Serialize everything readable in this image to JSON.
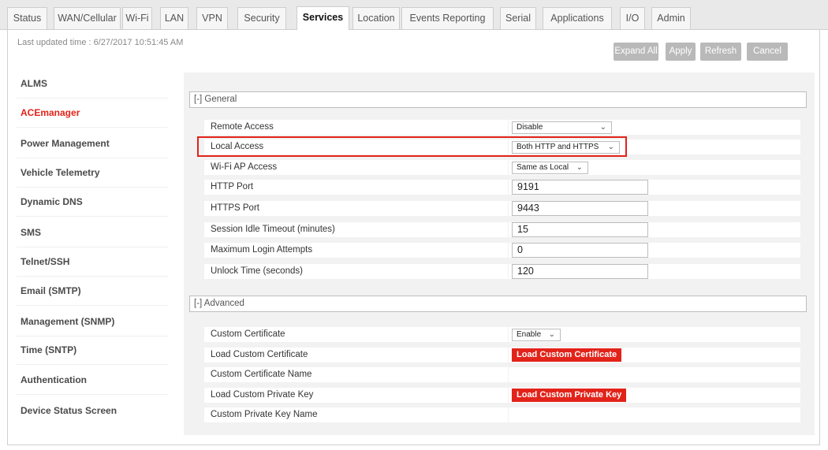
{
  "tabs": [
    {
      "label": "Status",
      "active": false
    },
    {
      "label": "WAN/Cellular",
      "active": false
    },
    {
      "label": "Wi-Fi",
      "active": false
    },
    {
      "label": "LAN",
      "active": false
    },
    {
      "label": "VPN",
      "active": false
    },
    {
      "label": "Security",
      "active": false
    },
    {
      "label": "Services",
      "active": true
    },
    {
      "label": "Location",
      "active": false
    },
    {
      "label": "Events Reporting",
      "active": false
    },
    {
      "label": "Serial",
      "active": false
    },
    {
      "label": "Applications",
      "active": false
    },
    {
      "label": "I/O",
      "active": false
    },
    {
      "label": "Admin",
      "active": false
    }
  ],
  "last_updated": "Last updated time : 6/27/2017 10:51:45 AM",
  "toolbar": {
    "expand_all": "Expand All",
    "apply": "Apply",
    "refresh": "Refresh",
    "cancel": "Cancel"
  },
  "sidebar": {
    "active_item": "ACEmanager",
    "items": [
      {
        "label": "ALMS"
      },
      {
        "label": "ACEmanager"
      },
      {
        "label": "Power Management"
      },
      {
        "label": "Vehicle Telemetry"
      },
      {
        "label": "Dynamic DNS"
      },
      {
        "label": "SMS"
      },
      {
        "label": "Telnet/SSH"
      },
      {
        "label": "Email (SMTP)"
      },
      {
        "label": "Management (SNMP)"
      },
      {
        "label": "Time (SNTP)"
      },
      {
        "label": "Authentication"
      },
      {
        "label": "Device Status Screen"
      }
    ]
  },
  "general": {
    "header": "[-] General",
    "remote_access": {
      "label": "Remote Access",
      "value": "Disable"
    },
    "local_access": {
      "label": "Local Access",
      "value": "Both HTTP and HTTPS"
    },
    "wifi_ap_access": {
      "label": "Wi-Fi AP Access",
      "value": "Same as Local"
    },
    "http_port": {
      "label": "HTTP Port",
      "value": "9191"
    },
    "https_port": {
      "label": "HTTPS Port",
      "value": "9443"
    },
    "session_idle_timeout": {
      "label": "Session Idle Timeout (minutes)",
      "value": "15"
    },
    "max_login_attempts": {
      "label": "Maximum Login Attempts",
      "value": "0"
    },
    "unlock_time": {
      "label": "Unlock Time (seconds)",
      "value": "120"
    }
  },
  "advanced": {
    "header": "[-] Advanced",
    "custom_certificate": {
      "label": "Custom Certificate",
      "value": "Enable"
    },
    "load_custom_certificate": {
      "label": "Load Custom Certificate",
      "button": "Load Custom Certificate"
    },
    "custom_certificate_name": {
      "label": "Custom Certificate Name",
      "value": ""
    },
    "load_custom_private_key": {
      "label": "Load Custom Private Key",
      "button": "Load Custom Private Key"
    },
    "custom_private_key_name": {
      "label": "Custom Private Key Name",
      "value": ""
    }
  },
  "colors": {
    "accent_red": "#e2231a",
    "disabled_button": "#b9b9b9",
    "panel_background": "#f2f2f2"
  },
  "icons": {
    "dropdown": "chevron-down-icon"
  }
}
